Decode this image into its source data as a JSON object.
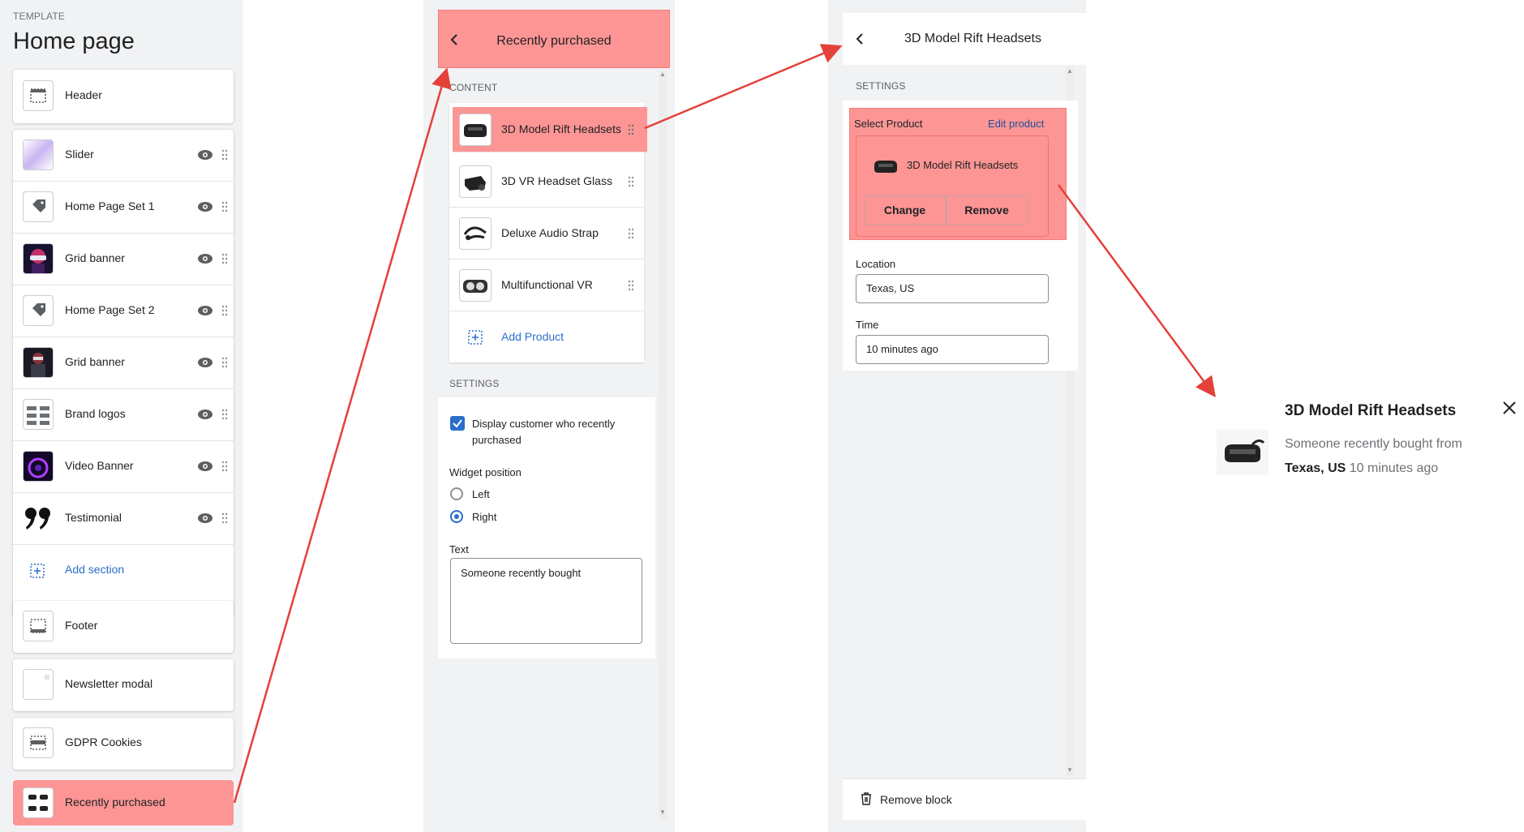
{
  "template": {
    "label": "TEMPLATE",
    "title": "Home page",
    "header": "Header",
    "sections": [
      {
        "label": "Slider",
        "icon": "slider-thumbnail"
      },
      {
        "label": "Home Page Set 1",
        "icon": "tag-icon"
      },
      {
        "label": "Grid banner",
        "icon": "grid-banner-thumbnail"
      },
      {
        "label": "Home Page Set 2",
        "icon": "tag-icon"
      },
      {
        "label": "Grid banner",
        "icon": "grid-banner-thumbnail"
      },
      {
        "label": "Brand logos",
        "icon": "brand-logos-thumbnail"
      },
      {
        "label": "Video Banner",
        "icon": "video-banner-thumbnail"
      },
      {
        "label": "Testimonial",
        "icon": "quote-icon"
      }
    ],
    "add_section": "Add section",
    "footer": "Footer",
    "newsletter": "Newsletter modal",
    "gdpr": "GDPR Cookies",
    "recently_purchased": "Recently purchased"
  },
  "block_panel": {
    "title": "Recently purchased",
    "content_label": "CONTENT",
    "products": [
      {
        "label": "3D Model Rift Headsets",
        "icon": "vr-headset-icon"
      },
      {
        "label": "3D VR Headset Glass",
        "icon": "vr-glass-icon"
      },
      {
        "label": "Deluxe Audio Strap",
        "icon": "audio-strap-icon"
      },
      {
        "label": "Multifunctional VR",
        "icon": "vr-goggles-icon"
      }
    ],
    "add_product": "Add Product",
    "settings_label": "SETTINGS",
    "display_customer": "Display customer who recently purchased",
    "display_customer_checked": true,
    "widget_position_label": "Widget position",
    "position_options": [
      "Left",
      "Right"
    ],
    "position_selected": "Right",
    "text_label": "Text",
    "text_value": "Someone recently bought"
  },
  "product_panel": {
    "title": "3D Model Rift Headsets",
    "settings_label": "SETTINGS",
    "select_product_label": "Select Product",
    "edit_product": "Edit product",
    "product_name": "3D Model Rift Headsets",
    "change": "Change",
    "remove": "Remove",
    "location_label": "Location",
    "location_value": "Texas, US",
    "time_label": "Time",
    "time_value": "10 minutes ago",
    "remove_block": "Remove block"
  },
  "toast": {
    "title": "3D Model Rift Headsets",
    "text_prefix": "Someone recently bought from",
    "location": "Texas, US",
    "time": "10 minutes ago"
  },
  "colors": {
    "highlight": "#fe9595",
    "arrow": "#e5403a",
    "link": "#2c6ecb"
  }
}
